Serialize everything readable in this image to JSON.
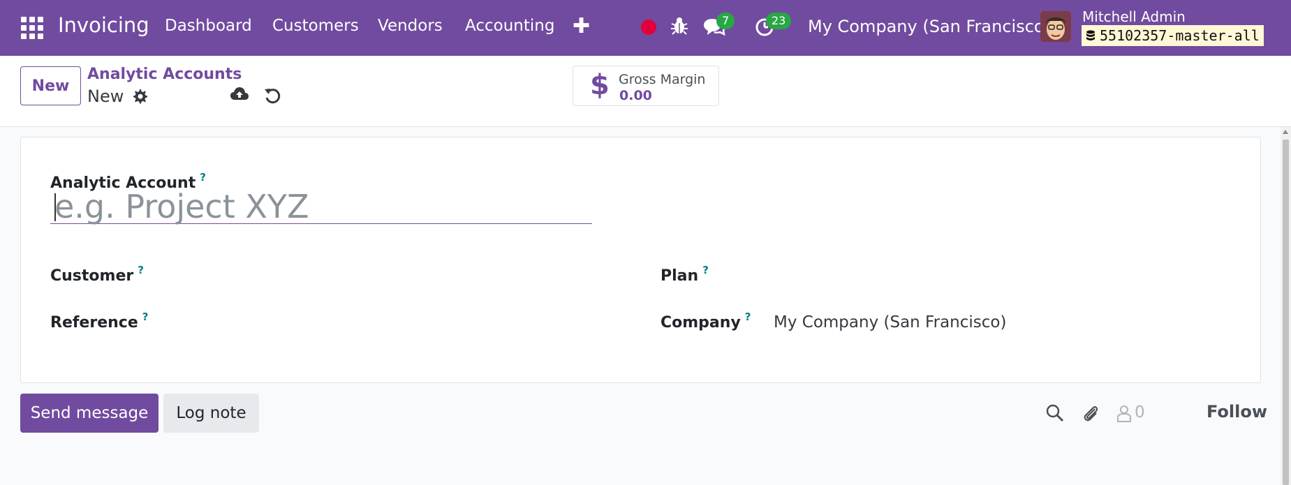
{
  "navbar": {
    "brand": "Invoicing",
    "menus": [
      "Dashboard",
      "Customers",
      "Vendors",
      "Accounting"
    ],
    "messages_count": "7",
    "activities_count": "23",
    "company": "My Company (San Francisco)",
    "user_name": "Mitchell Admin",
    "database": "55102357-master-all",
    "brand_color": "#714b9f"
  },
  "control_panel": {
    "new_button": "New",
    "breadcrumb_parent": "Analytic Accounts",
    "breadcrumb_current": "New",
    "smart_button": {
      "label": "Gross Margin",
      "value": "0.00"
    }
  },
  "form": {
    "name_label": "Analytic Account",
    "name_placeholder": "e.g. Project XYZ",
    "help_mark": "?",
    "customer_label": "Customer",
    "reference_label": "Reference",
    "plan_label": "Plan",
    "company_label": "Company",
    "company_value": "My Company (San Francisco)"
  },
  "chatter": {
    "send_message": "Send message",
    "log_note": "Log note",
    "followers_count": "0",
    "follow": "Follow"
  }
}
